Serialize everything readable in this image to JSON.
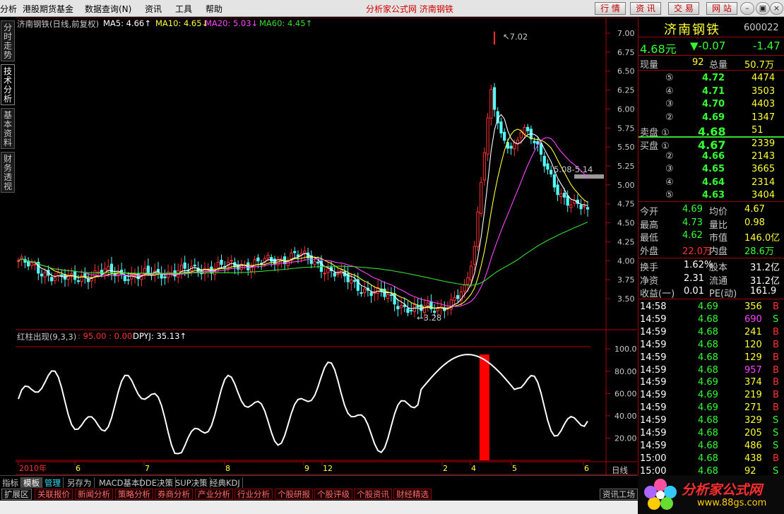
{
  "menu": {
    "items": [
      "分析",
      "港股期货基金",
      "数据查询(N)",
      "资讯",
      "工具",
      "帮助"
    ],
    "title": "分析家公式网  济南钢铁",
    "buttons": [
      "行 情",
      "资 讯",
      "交 易",
      "网 站"
    ]
  },
  "vtabs": [
    "分时走势",
    "技术分析",
    "基本资料",
    "财务透视"
  ],
  "main_legend": {
    "name": "济南钢铁(日线,前复权)",
    "ma5": "MA5: 4.66↑",
    "ma10": "MA10: 4.65↓",
    "ma20": "MA20: 5.03↓",
    "ma60": "MA60: 4.45↑"
  },
  "sub_legend": {
    "name": "红柱出现(9,3,3)",
    "vals": ": 95.00 : 0.00",
    "dpyj": "DPYJ: 35.13↑"
  },
  "annotations": {
    "high": "7.02",
    "low": "3.28",
    "band": "5.08-5.14"
  },
  "colors": {
    "ma5": "#ffffff",
    "ma10": "#ffff33",
    "ma20": "#ff44ff",
    "ma60": "#33dd33",
    "up": "#ff3232",
    "down": "#54fcfc",
    "red_line": "#b00000",
    "accent_red": "#ff0000"
  },
  "chart_data": [
    {
      "type": "candlestick",
      "title": "济南钢铁(日线,前复权)",
      "y_ticks": [
        "7.00",
        "6.75",
        "6.50",
        "6.25",
        "6.00",
        "5.75",
        "5.50",
        "5.25",
        "5.00",
        "4.75",
        "4.50",
        "4.25",
        "4.00",
        "3.75",
        "3.50"
      ],
      "ylim": [
        3.35,
        7.1
      ],
      "x_labels": [
        "2010年",
        "6",
        "7",
        "8",
        "9",
        "12",
        "2",
        "4",
        "5",
        "6"
      ],
      "annotations": {
        "max": 7.02,
        "min": 3.28
      },
      "series": [
        {
          "name": "MA5",
          "value": 4.66
        },
        {
          "name": "MA10",
          "value": 4.65
        },
        {
          "name": "MA20",
          "value": 5.03
        },
        {
          "name": "MA60",
          "value": 4.45
        }
      ]
    },
    {
      "type": "line",
      "title": "红柱出现(9,3,3)",
      "y_ticks": [
        "100.00",
        "80.00",
        "60.00",
        "40.00",
        "20.00"
      ],
      "ylim": [
        0,
        100
      ],
      "series": [
        {
          "name": "DPYJ",
          "last": 35.13
        }
      ],
      "bar_value": 95.0
    }
  ],
  "quote": {
    "name": "济南钢铁",
    "code": "600022",
    "price": "4.68元",
    "change": "▼-0.07",
    "pct": "-1.47",
    "xianliang_label": "现量",
    "xianliang": "92",
    "zongliang_label": "总量",
    "zongliang": "50.7万",
    "sells": [
      {
        "label": "⑤",
        "price": "4.72",
        "vol": "4474"
      },
      {
        "label": "④",
        "price": "4.71",
        "vol": "3503"
      },
      {
        "label": "③",
        "price": "4.70",
        "vol": "4403"
      },
      {
        "label": "②",
        "price": "4.69",
        "vol": "1347"
      },
      {
        "label": "卖盘 ①",
        "price": "4.68",
        "vol": "51"
      }
    ],
    "buys": [
      {
        "label": "买盘 ①",
        "price": "4.67",
        "vol": "2339"
      },
      {
        "label": "②",
        "price": "4.66",
        "vol": "2143"
      },
      {
        "label": "③",
        "price": "4.65",
        "vol": "3665"
      },
      {
        "label": "④",
        "price": "4.64",
        "vol": "2314"
      },
      {
        "label": "⑤",
        "price": "4.63",
        "vol": "3404"
      }
    ],
    "stats": [
      {
        "l1": "今开",
        "v1": "4.69",
        "l2": "均价",
        "v2": "4.67"
      },
      {
        "l1": "最高",
        "v1": "4.73",
        "l2": "量比",
        "v2": "0.98"
      },
      {
        "l1": "最低",
        "v1": "4.62",
        "l2": "市值",
        "v2": "146.0亿"
      },
      {
        "l1": "外盘",
        "v1": "22.0万",
        "l2": "内盘",
        "v2": "28.6万"
      }
    ],
    "stats2": [
      {
        "l1": "换手",
        "v1": "1.62%",
        "l2": "股本",
        "v2": "31.2亿"
      },
      {
        "l1": "净资",
        "v1": "2.31",
        "l2": "流通",
        "v2": "31.2亿"
      },
      {
        "l1": "收益(一)",
        "v1": "0.01",
        "l2": "PE(动)",
        "v2": "161.9"
      }
    ],
    "ticks": [
      {
        "t": "14:58",
        "p": "4.69",
        "v": "356",
        "s": "B"
      },
      {
        "t": "14:59",
        "p": "4.68",
        "v": "690",
        "s": "S"
      },
      {
        "t": "14:59",
        "p": "4.68",
        "v": "241",
        "s": "B"
      },
      {
        "t": "14:59",
        "p": "4.68",
        "v": "120",
        "s": "B"
      },
      {
        "t": "14:59",
        "p": "4.68",
        "v": "129",
        "s": "B"
      },
      {
        "t": "14:59",
        "p": "4.68",
        "v": "957",
        "s": "B"
      },
      {
        "t": "14:59",
        "p": "4.69",
        "v": "374",
        "s": "B"
      },
      {
        "t": "14:59",
        "p": "4.69",
        "v": "219",
        "s": "B"
      },
      {
        "t": "14:59",
        "p": "4.69",
        "v": "271",
        "s": "B"
      },
      {
        "t": "14:59",
        "p": "4.68",
        "v": "329",
        "s": "S"
      },
      {
        "t": "14:59",
        "p": "4.68",
        "v": "205",
        "s": "S"
      },
      {
        "t": "14:59",
        "p": "4.68",
        "v": "486",
        "s": "S"
      },
      {
        "t": "15:00",
        "p": "4.68",
        "v": "438",
        "s": "B"
      },
      {
        "t": "15:00",
        "p": "4.68",
        "v": "92",
        "s": "S"
      }
    ]
  },
  "period_label": "日线",
  "nav_symbols": [
    "+",
    "-",
    "0"
  ],
  "bottom_tabs": [
    "指标",
    "模板",
    "管理",
    "另存为",
    "MACD基本",
    "DDE决策",
    "SUP决策",
    "经典KDJ"
  ],
  "sub_tabs": [
    "扩展区",
    "关联报价",
    "新闻分析",
    "策略分析",
    "券商分析",
    "产业分析",
    "行业分析",
    "个股研报",
    "个股评级",
    "个股资讯",
    "财经精选"
  ],
  "sub_right": "资讯工场",
  "logo": {
    "text": "分析家公式网",
    "url": "www.88gs.com"
  }
}
